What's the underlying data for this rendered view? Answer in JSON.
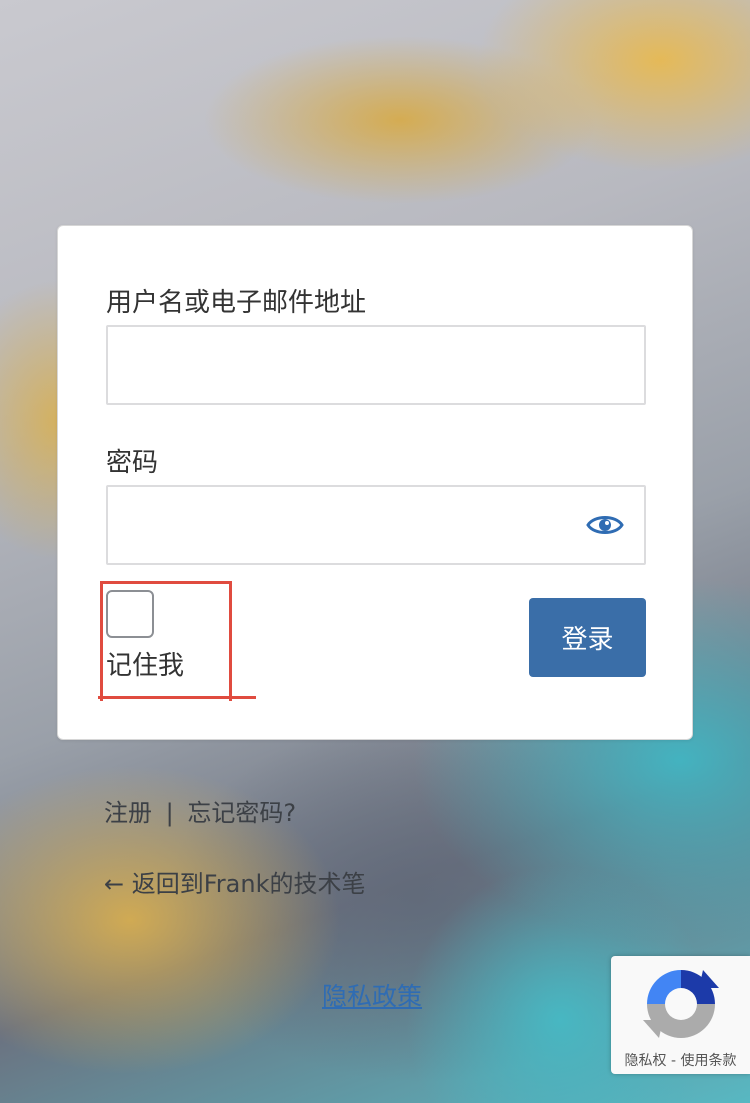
{
  "form": {
    "username_label": "用户名或电子邮件地址",
    "username_value": "",
    "password_label": "密码",
    "password_value": "",
    "remember_label": "记住我",
    "login_button_label": "登录",
    "show_password_icon": "eye-icon"
  },
  "links": {
    "register": "注册",
    "separator": "|",
    "forgot_password": "忘记密码?",
    "back_to_site": "← 返回到Frank的技术笔",
    "privacy_policy": "隐私政策"
  },
  "recaptcha": {
    "privacy": "隐私权",
    "separator": "-",
    "terms": "使用条款"
  },
  "colors": {
    "primary_button": "#3a6ea8",
    "annotation": "#e04b3f",
    "link": "#2f6cb3"
  }
}
